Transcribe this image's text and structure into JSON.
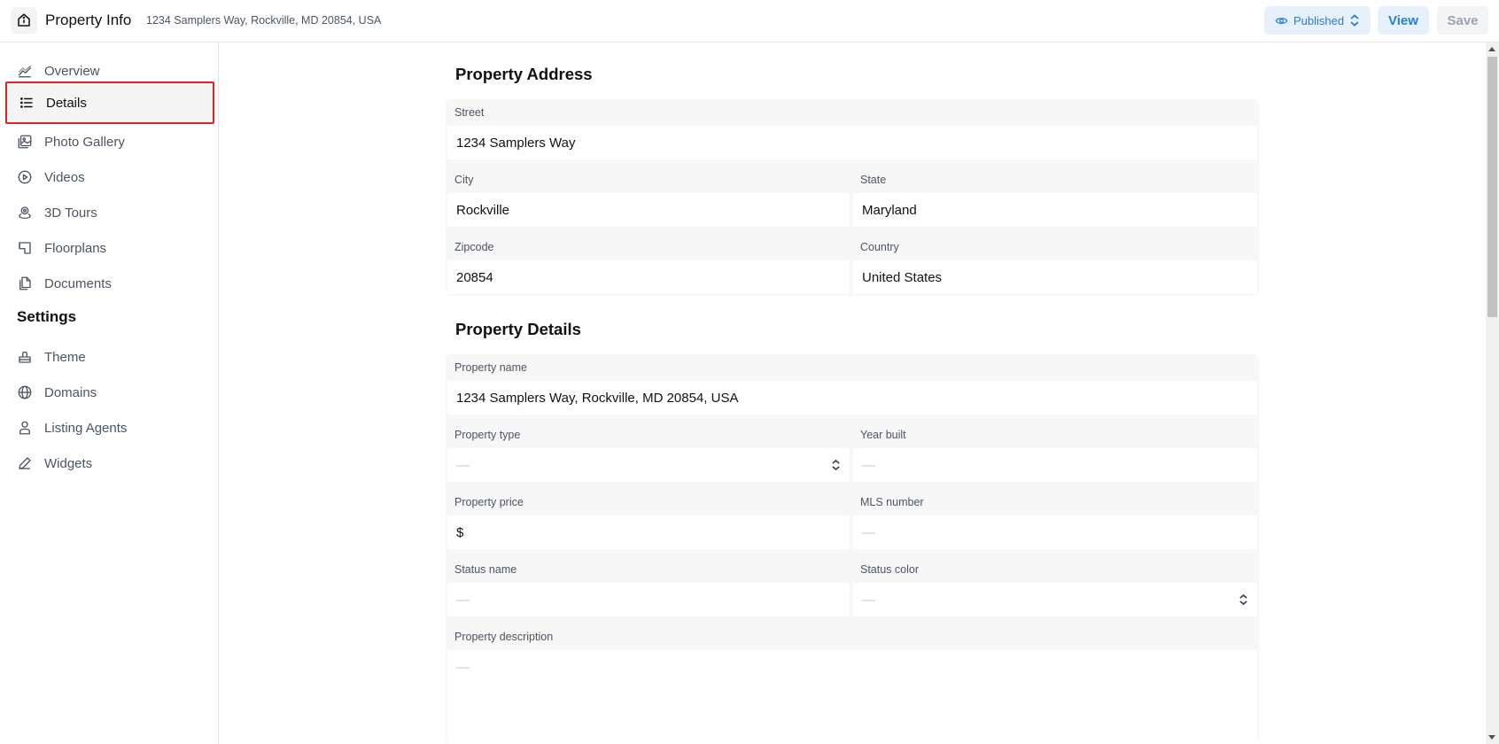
{
  "header": {
    "title": "Property Info",
    "subtitle": "1234 Samplers Way, Rockville, MD 20854, USA",
    "published_label": "Published",
    "view_label": "View",
    "save_label": "Save"
  },
  "sidebar": {
    "items": [
      {
        "label": "Overview",
        "icon": "chart-icon"
      },
      {
        "label": "Details",
        "icon": "list-icon"
      },
      {
        "label": "Photo Gallery",
        "icon": "photo-icon"
      },
      {
        "label": "Videos",
        "icon": "play-icon"
      },
      {
        "label": "3D Tours",
        "icon": "tour-icon"
      },
      {
        "label": "Floorplans",
        "icon": "floorplan-icon"
      },
      {
        "label": "Documents",
        "icon": "documents-icon"
      }
    ],
    "settings_title": "Settings",
    "settings_items": [
      {
        "label": "Theme",
        "icon": "theme-icon"
      },
      {
        "label": "Domains",
        "icon": "globe-icon"
      },
      {
        "label": "Listing Agents",
        "icon": "user-icon"
      },
      {
        "label": "Widgets",
        "icon": "pen-icon"
      }
    ]
  },
  "address": {
    "title": "Property Address",
    "street_label": "Street",
    "street": "1234 Samplers Way",
    "city_label": "City",
    "city": "Rockville",
    "state_label": "State",
    "state": "Maryland",
    "zip_label": "Zipcode",
    "zip": "20854",
    "country_label": "Country",
    "country": "United States"
  },
  "details": {
    "title": "Property Details",
    "name_label": "Property name",
    "name": "1234 Samplers Way, Rockville, MD 20854, USA",
    "type_label": "Property type",
    "type": "—",
    "year_label": "Year built",
    "year": "—",
    "price_label": "Property price",
    "price": "$",
    "mls_label": "MLS number",
    "mls": "—",
    "status_name_label": "Status name",
    "status_name": "—",
    "status_color_label": "Status color",
    "status_color": "—",
    "description_label": "Property description",
    "description": "—"
  },
  "colors": {
    "accent": "#2b7bd3",
    "highlight": "#e02424"
  }
}
